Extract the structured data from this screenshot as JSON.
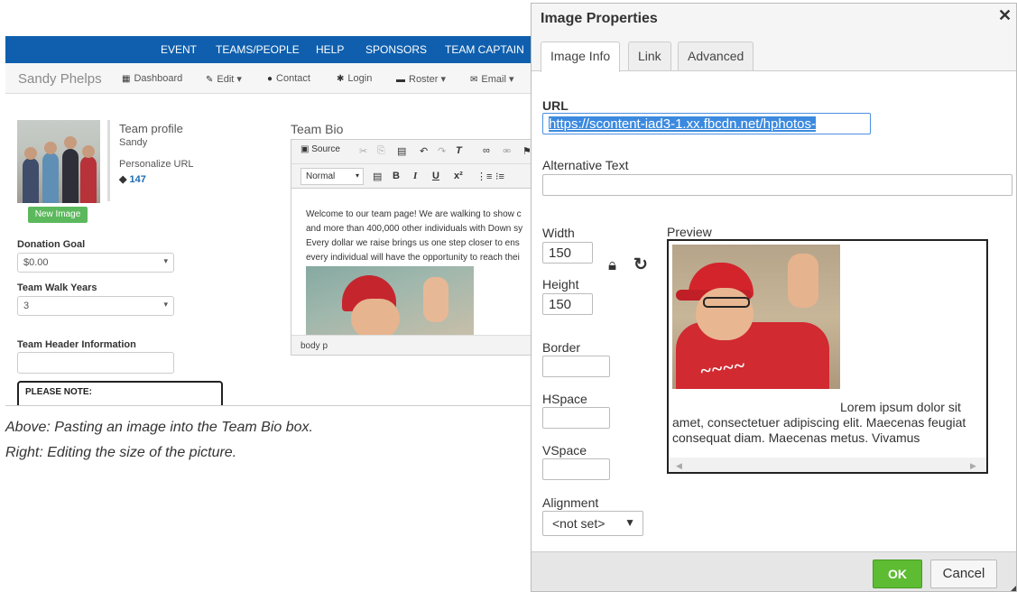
{
  "page": {
    "caption_line1": "Above: Pasting an image into the Team Bio box.",
    "caption_line2": "Right: Editing the size of the picture."
  },
  "site": {
    "topnav": [
      "EVENT",
      "TEAMS/PEOPLE",
      "HELP",
      "SPONSORS",
      "TEAM CAPTAIN"
    ],
    "brand": "Sandy Phelps",
    "subnav": [
      {
        "icon": "dashboard-icon",
        "label": "Dashboard"
      },
      {
        "icon": "pencil-icon",
        "label": "Edit ▾"
      },
      {
        "icon": "user-icon",
        "label": "Contact"
      },
      {
        "icon": "asterisk-icon",
        "label": "Login"
      },
      {
        "icon": "briefcase-icon",
        "label": "Roster ▾"
      },
      {
        "icon": "envelope-icon",
        "label": "Email ▾"
      }
    ],
    "profile_title": "Team profile",
    "profile_name": "Sandy",
    "personalize_url": "Personalize URL",
    "tag_count": "147",
    "new_image_label": "New Image",
    "donation_goal_label": "Donation Goal",
    "donation_goal_value": "$0.00",
    "walk_years_label": "Team Walk Years",
    "walk_years_value": "3",
    "header_info_label": "Team Header Information",
    "note_title": "PLEASE NOTE:",
    "team_bio_title": "Team Bio",
    "editor_source": "Source",
    "editor_style": "Normal",
    "editor_text": [
      "Welcome to our team page!  We are walking to show c",
      "and more than 400,000 other individuals with Down sy",
      "Every dollar we raise brings us one step closer to ens",
      "every individual will have the opportunity to reach thei"
    ],
    "status_path": "body  p"
  },
  "dialog": {
    "title": "Image Properties",
    "tabs": [
      "Image Info",
      "Link",
      "Advanced"
    ],
    "url_label": "URL",
    "url_value": "https://scontent-iad3-1.xx.fbcdn.net/hphotos-",
    "alt_label": "Alternative Text",
    "alt_value": "",
    "width_label": "Width",
    "width_value": "150",
    "height_label": "Height",
    "height_value": "150",
    "border_label": "Border",
    "hspace_label": "HSpace",
    "vspace_label": "VSpace",
    "alignment_label": "Alignment",
    "alignment_value": "<not set>",
    "preview_label": "Preview",
    "preview_text": "Lorem ipsum dolor sit amet, consectetuer adipiscing elit. Maecenas feugiat consequat diam. Maecenas metus. Vivamus",
    "ok_label": "OK",
    "cancel_label": "Cancel"
  }
}
